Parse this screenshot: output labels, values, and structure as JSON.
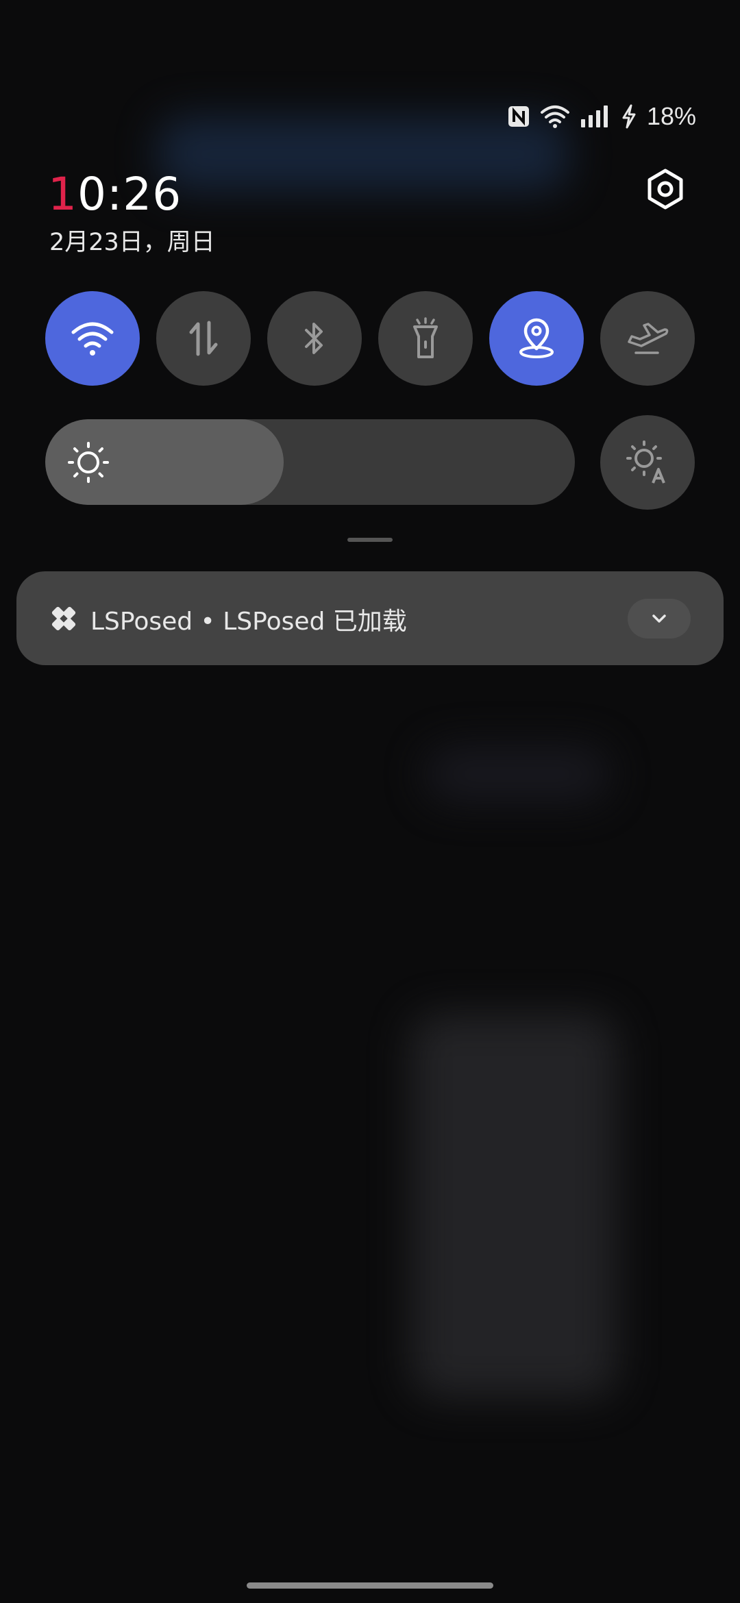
{
  "status_bar": {
    "icons": [
      "nfc-icon",
      "wifi-icon",
      "signal-icon",
      "charging-icon"
    ],
    "battery_text": "18%"
  },
  "header": {
    "time_first": "1",
    "time_rest": "0:26",
    "date": "2月23日，周日",
    "settings_icon": "settings-hex-icon"
  },
  "quick_toggles": [
    {
      "name": "wifi",
      "icon": "wifi-icon",
      "active": true
    },
    {
      "name": "mobile-data",
      "icon": "data-arrows-icon",
      "active": false
    },
    {
      "name": "bluetooth",
      "icon": "bluetooth-icon",
      "active": false
    },
    {
      "name": "flashlight",
      "icon": "flashlight-icon",
      "active": false
    },
    {
      "name": "location",
      "icon": "location-icon",
      "active": true
    },
    {
      "name": "airplane-mode",
      "icon": "airplane-icon",
      "active": false
    }
  ],
  "brightness": {
    "level": 0.45,
    "icon": "sun-icon",
    "auto_icon": "auto-brightness-icon"
  },
  "notification": {
    "app_icon": "lsposed-icon",
    "text": "LSPosed • LSPosed 已加载",
    "expand_icon": "chevron-down-icon"
  },
  "colors": {
    "accent": "#4e67dd",
    "clock_highlight": "#e0234b",
    "tile_off": "#3d3d3d"
  }
}
